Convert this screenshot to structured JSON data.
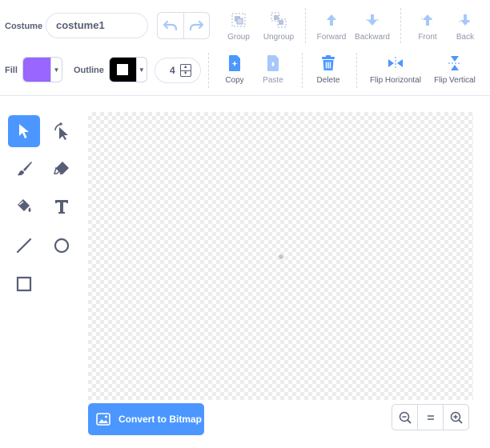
{
  "costume": {
    "label": "Costume",
    "name_value": "costume1"
  },
  "toolbar_top": {
    "group": "Group",
    "ungroup": "Ungroup",
    "forward": "Forward",
    "backward": "Backward",
    "front": "Front",
    "back": "Back"
  },
  "fill": {
    "label": "Fill",
    "color": "#9966ff"
  },
  "outline": {
    "label": "Outline",
    "color": "#000000",
    "size": "4"
  },
  "toolbar_bottom": {
    "copy": "Copy",
    "paste": "Paste",
    "delete": "Delete",
    "flip_horizontal": "Flip Horizontal",
    "flip_vertical": "Flip Vertical"
  },
  "convert_button": {
    "label": "Convert to Bitmap"
  },
  "colors": {
    "accent": "#4c97ff",
    "delete": "#4c97ff",
    "text": "#575e75"
  }
}
